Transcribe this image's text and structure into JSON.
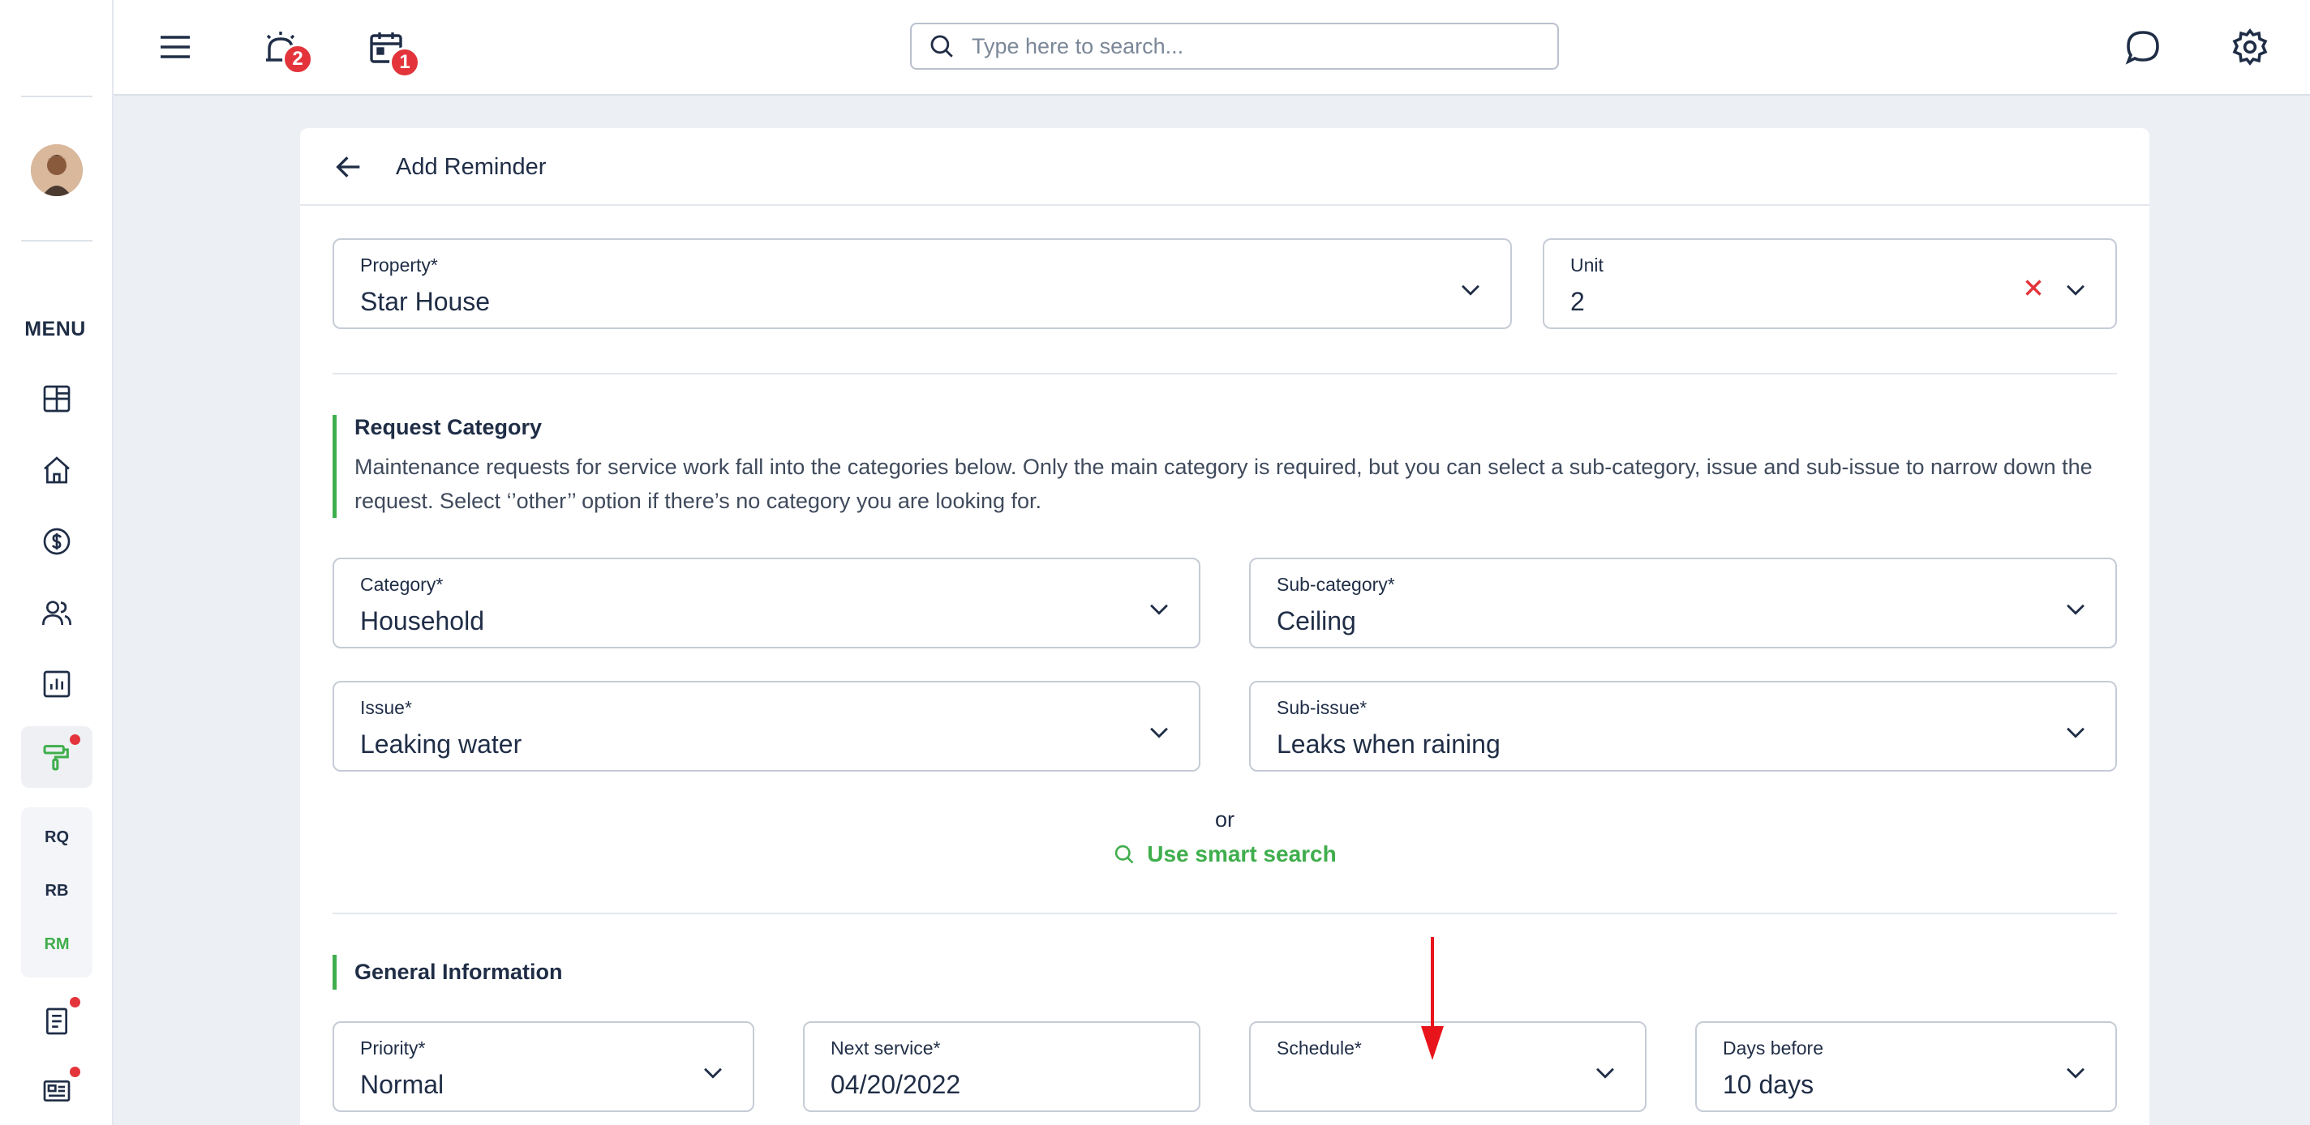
{
  "sidebar": {
    "menu_label": "MENU",
    "subnav": [
      "RQ",
      "RB",
      "RM"
    ]
  },
  "topbar": {
    "notifications_count": "2",
    "calendar_count": "1",
    "search_placeholder": "Type here to search..."
  },
  "page": {
    "title": "Add Reminder"
  },
  "form": {
    "property": {
      "label": "Property*",
      "value": "Star House"
    },
    "unit": {
      "label": "Unit",
      "value": "2"
    },
    "request_category": {
      "title": "Request Category",
      "description": "Maintenance requests for service work fall into the categories below. Only the main category is required, but you can select a sub-category, issue and sub-issue to narrow down the request. Select ‘’other’’ option if there’s no category you are looking for."
    },
    "category": {
      "label": "Category*",
      "value": "Household"
    },
    "sub_category": {
      "label": "Sub-category*",
      "value": "Ceiling"
    },
    "issue": {
      "label": "Issue*",
      "value": "Leaking water"
    },
    "sub_issue": {
      "label": "Sub-issue*",
      "value": "Leaks when raining"
    },
    "or_text": "or",
    "smart_search": "Use smart search",
    "general_information": {
      "title": "General Information"
    },
    "priority": {
      "label": "Priority*",
      "value": "Normal"
    },
    "next_service": {
      "label": "Next service*",
      "value": "04/20/2022"
    },
    "schedule": {
      "label": "Schedule*",
      "value": ""
    },
    "days_before": {
      "label": "Days before",
      "value": "10 days"
    }
  },
  "colors": {
    "accent_green": "#3fae4c",
    "badge_red": "#e3343b",
    "text_navy": "#1f2d46",
    "annotation_arrow": "#e8141b"
  }
}
